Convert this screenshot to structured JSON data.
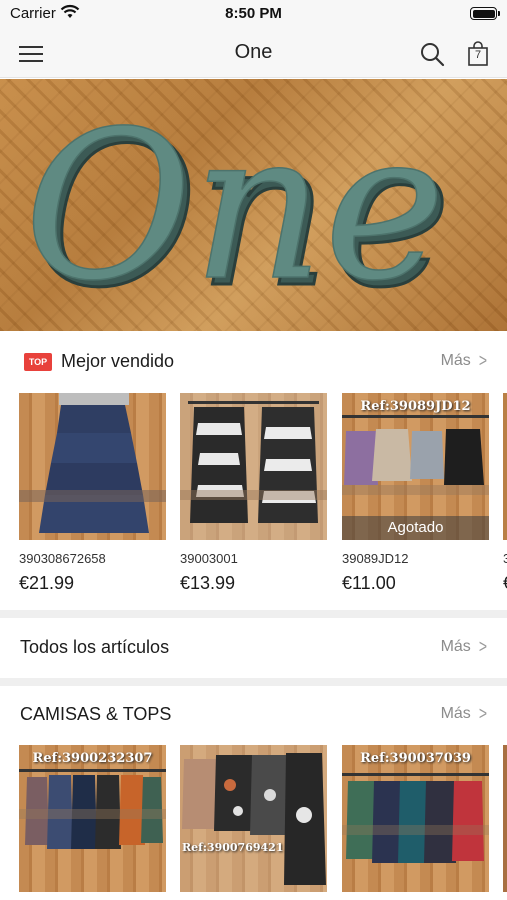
{
  "status_bar": {
    "carrier": "Carrier",
    "time": "8:50 PM"
  },
  "nav": {
    "title": "One",
    "cart_count": "7"
  },
  "hero": {
    "logo_text": "One"
  },
  "best_sellers": {
    "badge": "TOP",
    "title": "Mejor vendido",
    "more": "Más",
    "products": [
      {
        "sku": "390308672658",
        "price": "€21.99",
        "sold_out": ""
      },
      {
        "sku": "39003001",
        "price": "€13.99",
        "sold_out": ""
      },
      {
        "sku": "39089JD12",
        "price": "€11.00",
        "sold_out": "Agotado",
        "image_label": "Ref:39089JD12"
      },
      {
        "sku": "3",
        "price": "€"
      }
    ]
  },
  "all_items": {
    "title": "Todos los artículos",
    "more": "Más"
  },
  "shirts_tops": {
    "title": "CAMISAS & TOPS",
    "more": "Más",
    "products": [
      {
        "image_label": "Ref:3900232307"
      },
      {
        "image_label": "Ref:3900769421"
      },
      {
        "image_label": "Ref:390037039"
      }
    ]
  },
  "colors": {
    "accent_red": "#e8413b",
    "bar_bg": "#f7f7f7",
    "divider": "#efefef",
    "muted_text": "#8c8c8c"
  }
}
